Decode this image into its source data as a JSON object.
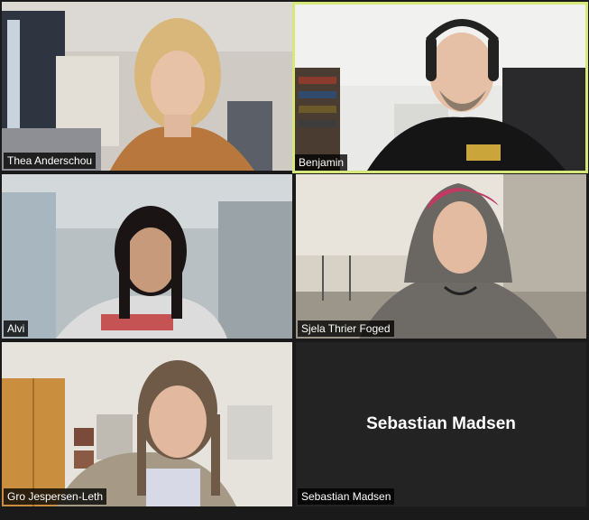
{
  "participants": [
    {
      "name": "Thea Anderschou",
      "video": true,
      "active_speaker": false
    },
    {
      "name": "Benjamin",
      "video": true,
      "active_speaker": true
    },
    {
      "name": "Alvi",
      "video": true,
      "active_speaker": false
    },
    {
      "name": "Sjela Thrier Foged",
      "video": true,
      "active_speaker": false
    },
    {
      "name": "Gro Jespersen-Leth",
      "video": true,
      "active_speaker": false
    },
    {
      "name": "Sebastian Madsen",
      "video": false,
      "active_speaker": false
    }
  ],
  "colors": {
    "background": "#1a1a1a",
    "active_speaker_border": "#d7e87a",
    "name_tag_bg": "#000000",
    "name_tag_text": "#ffffff"
  }
}
